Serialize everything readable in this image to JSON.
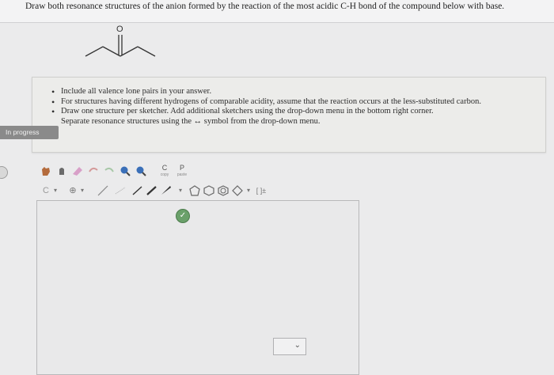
{
  "question": {
    "text": "Draw both resonance structures of the anion formed by the reaction of the most acidic C-H bond of the compound below with base."
  },
  "molecule": {
    "atom_label": "O"
  },
  "instructions": {
    "items": [
      "Include all valence lone pairs in your answer.",
      "For structures having different hydrogens of comparable acidity, assume that the reaction occurs at the less-substituted carbon.",
      "Draw one structure per sketcher. Add additional sketchers using the drop-down menu in the bottom right corner.",
      "Separate resonance structures using the ↔ symbol from the drop-down menu."
    ]
  },
  "status_badge": {
    "label": "In progress"
  },
  "toolbar": {
    "copy_label": "C",
    "copy_sub": "copy",
    "paste_label": "P",
    "paste_sub": "paste",
    "bracket_label": "[ ]±"
  },
  "colors": {
    "background": "#ebebec",
    "badge": "#8a8a8a",
    "check": "#6aa06a"
  }
}
